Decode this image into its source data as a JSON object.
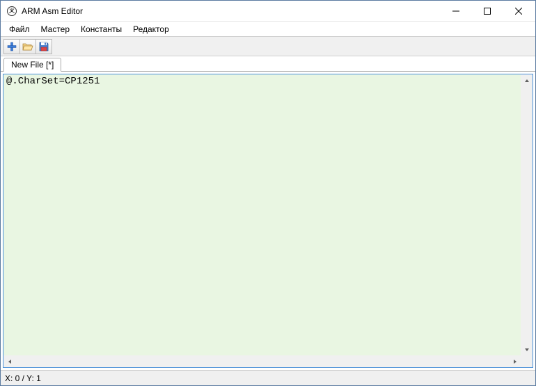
{
  "window": {
    "title": "ARM Asm Editor"
  },
  "menu": {
    "items": [
      "Файл",
      "Мастер",
      "Константы",
      "Редактор"
    ]
  },
  "toolbar": {
    "buttons": [
      {
        "name": "new-file-button",
        "icon": "plus-icon"
      },
      {
        "name": "open-file-button",
        "icon": "folder-open-icon"
      },
      {
        "name": "save-file-button",
        "icon": "floppy-save-icon"
      }
    ]
  },
  "tabs": {
    "items": [
      {
        "label": "New File [*]",
        "active": true
      }
    ]
  },
  "editor": {
    "content": "@.CharSet=CP1251"
  },
  "status": {
    "cursor": "X: 0 / Y: 1"
  }
}
